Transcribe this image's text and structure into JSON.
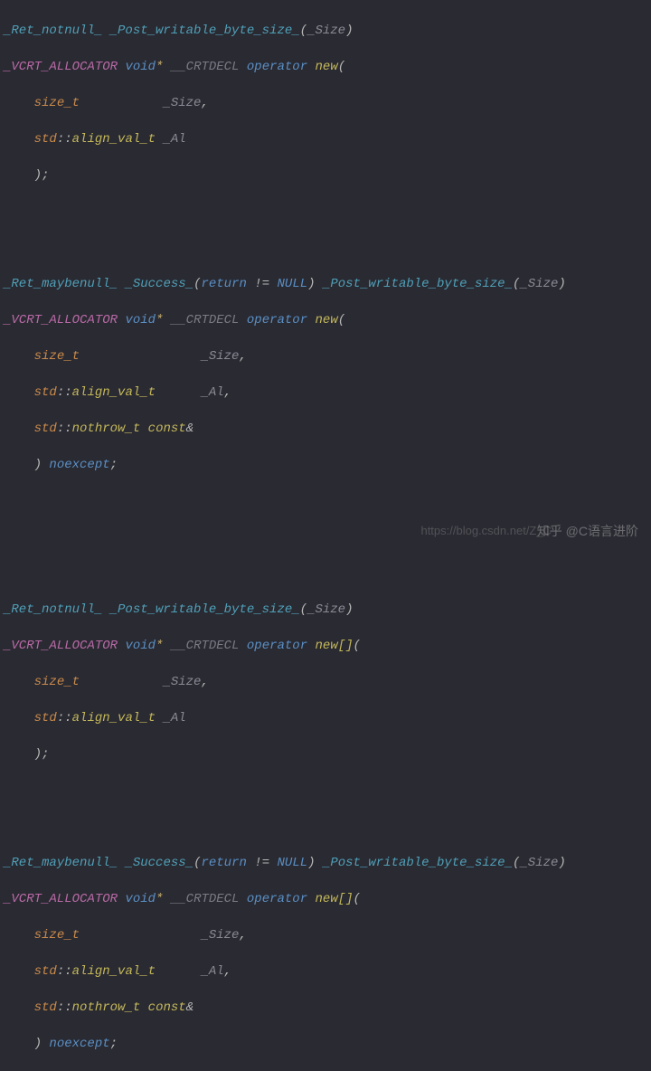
{
  "watermark1": "知乎 @C语言进阶",
  "watermark2": "https://blog.csdn.net/Z_C",
  "tok": {
    "ret_notnull": "_Ret_notnull_",
    "ret_maybenull": "_Ret_maybenull_",
    "success": "_Success_",
    "post_wbs": "_Post_writable_byte_size_",
    "vcrt_alloc": "_VCRT_ALLOCATOR",
    "void": "void",
    "star": "*",
    "crtdecl": "__CRTDECL",
    "operator": "operator",
    "new": "new",
    "new_arr": "new[]",
    "size_t": "size_t",
    "std": "std",
    "align_val_t": "align_val_t",
    "nothrow_t": "nothrow_t",
    "const": "const",
    "amp": "&",
    "Size": "_Size",
    "Al": "_Al",
    "noexcept": "noexcept",
    "return": "return",
    "ne": "!=",
    "NULL": "NULL",
    "lparen": "(",
    "rparen": ")",
    "comma": ",",
    "semi": ";",
    "scope": "::"
  }
}
